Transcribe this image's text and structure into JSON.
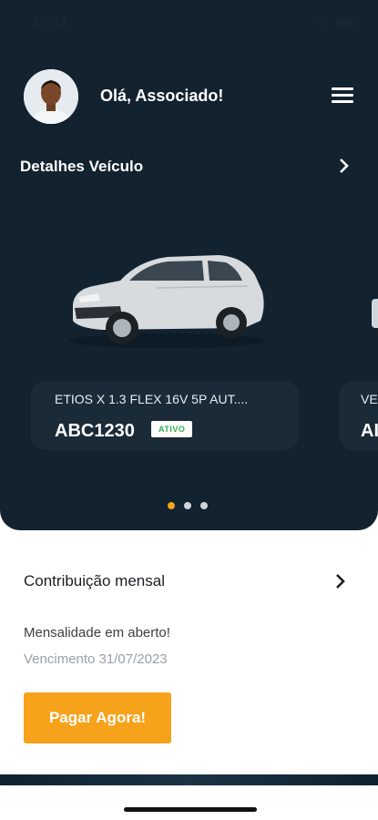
{
  "status_bar": {
    "time": "11:34"
  },
  "header": {
    "greeting": "Olá, Associado!"
  },
  "vehicles_section": {
    "title": "Detalhes Veículo"
  },
  "vehicles": [
    {
      "model": "ETIOS X 1.3 FLEX 16V 5P AUT....",
      "plate": "ABC1230",
      "status": "ATIVO"
    },
    {
      "model": "VE",
      "plate": "AI"
    }
  ],
  "carousel": {
    "count": 3,
    "active_index": 0
  },
  "contribution": {
    "title": "Contribuição mensal",
    "message": "Mensalidade em aberto!",
    "due_date": "Vencimento 31/07/2023",
    "pay_label": "Pagar Agora!"
  },
  "colors": {
    "hero_bg": "#12222f",
    "accent": "#f7a21b",
    "active_badge": "#2fb04f"
  },
  "icons": [
    "wifi-icon",
    "battery-icon",
    "menu-icon",
    "chevron-right-icon"
  ]
}
